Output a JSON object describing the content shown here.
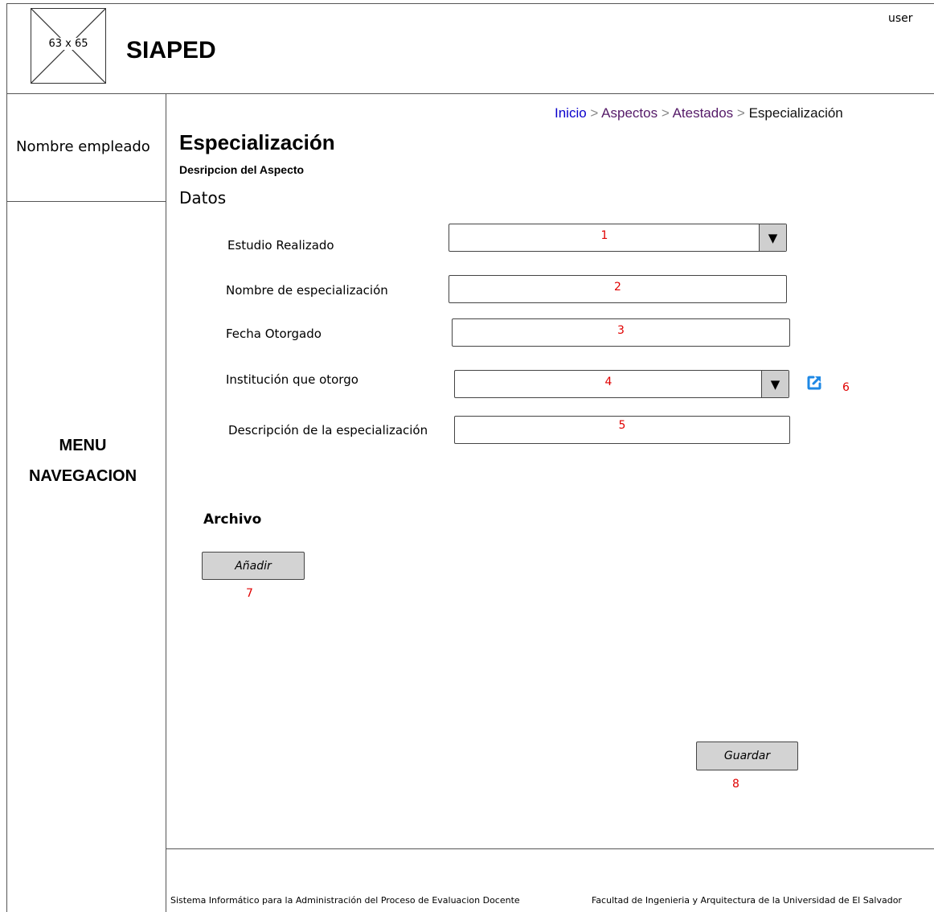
{
  "header": {
    "logo_placeholder": "63 x 65",
    "app_title": "SIAPED",
    "user": "user"
  },
  "sidebar": {
    "employee_name": "Nombre empleado",
    "menu_line1": "MENU",
    "menu_line2": "NAVEGACION"
  },
  "breadcrumb": {
    "items": [
      "Inicio",
      "Aspectos",
      "Atestados",
      "Especialización"
    ],
    "separator": ">"
  },
  "page": {
    "title": "Especialización",
    "subtitle": "Desripcion del Aspecto",
    "section_title": "Datos"
  },
  "form": {
    "fields": [
      {
        "label": "Estudio Realizado",
        "marker": "1",
        "type": "select"
      },
      {
        "label": "Nombre de especialización",
        "marker": "2",
        "type": "text"
      },
      {
        "label": "Fecha Otorgado",
        "marker": "3",
        "type": "text"
      },
      {
        "label": "Institución que otorgo",
        "marker": "4",
        "type": "select"
      },
      {
        "label": "Descripción de la especialización",
        "marker": "5",
        "type": "text"
      }
    ],
    "dropdown_arrow": "▼",
    "external_link_marker": "6",
    "external_link_icon": "external-link-icon"
  },
  "archivo": {
    "title": "Archivo",
    "add_button": "Añadir",
    "add_marker": "7"
  },
  "actions": {
    "save_button": "Guardar",
    "save_marker": "8"
  },
  "footer": {
    "left": "Sistema Informático para la Administración del Proceso de Evaluacion Docente",
    "right": "Facultad de Ingenieria y Arquitectura de la Universidad de El Salvador"
  },
  "colors": {
    "breadcrumb_home": "#0a00cc",
    "breadcrumb_link": "#551a68",
    "marker": "#e00000",
    "button_bg": "#d3d3d3",
    "icon": "#1e88e5"
  }
}
